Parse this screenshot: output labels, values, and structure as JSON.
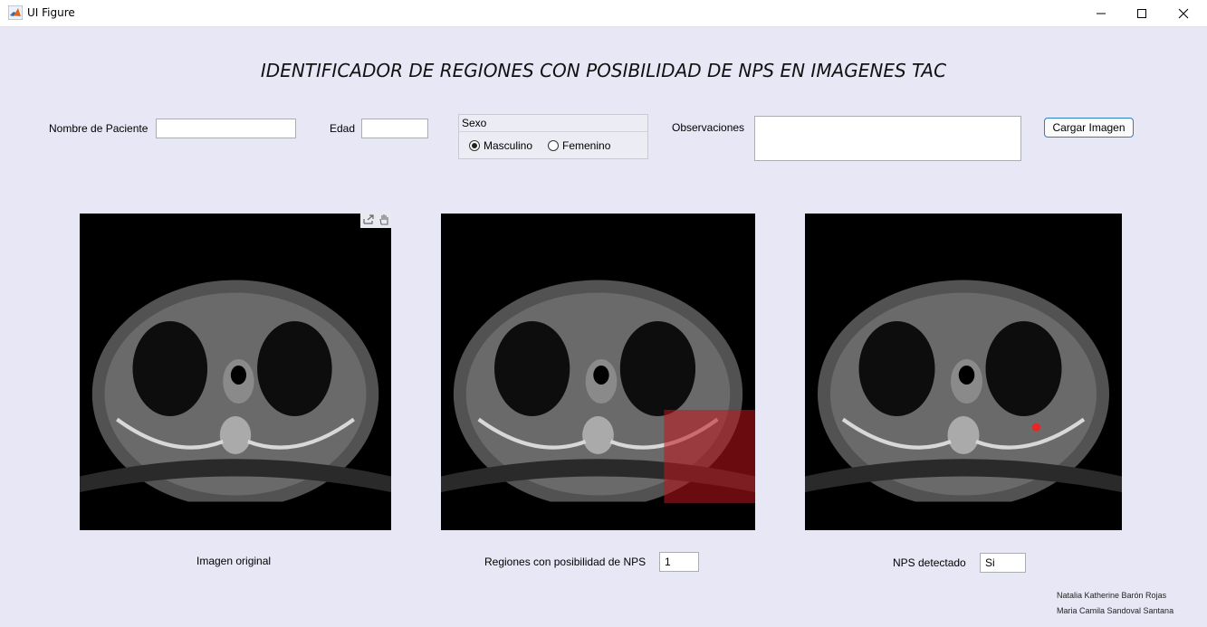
{
  "window": {
    "title": "UI Figure"
  },
  "heading": "IDENTIFICADOR DE REGIONES CON POSIBILIDAD DE NPS EN IMAGENES TAC",
  "form": {
    "nombre_label": "Nombre de Paciente",
    "nombre_value": "",
    "edad_label": "Edad",
    "edad_value": "",
    "sexo": {
      "title": "Sexo",
      "options": [
        "Masculino",
        "Femenino"
      ],
      "selected": "Masculino"
    },
    "observaciones_label": "Observaciones",
    "observaciones_value": "",
    "cargar_button": "Cargar Imagen"
  },
  "images": {
    "original_caption": "Imagen original",
    "regiones_label": "Regiones con posibilidad de NPS",
    "regiones_value": "1",
    "nps_label": "NPS detectado",
    "nps_value": "Si"
  },
  "credits": [
    "Natalia Katherine Barón Rojas",
    "Maria Camila Sandoval Santana"
  ],
  "colors": {
    "background": "#e8e7f6",
    "button_border": "#2b80c4",
    "region_highlight": "#c0141c"
  },
  "icons": [
    "matlab-icon",
    "minimize-icon",
    "maximize-icon",
    "close-icon",
    "export-icon",
    "pan-hand-icon"
  ]
}
